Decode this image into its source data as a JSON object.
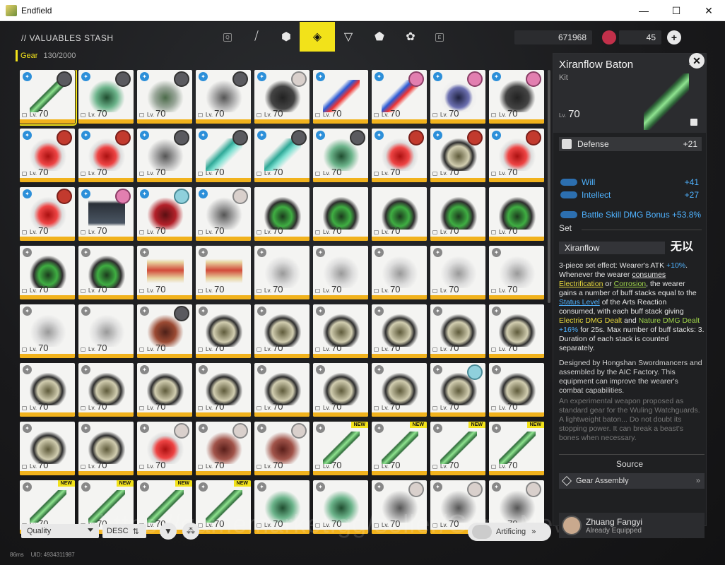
{
  "window": {
    "title": "Endfield",
    "minimize": "—",
    "maximize": "☐",
    "close": "✕"
  },
  "topbar": {
    "stash_title": "// VALUABLES STASH",
    "key_q": "Q",
    "key_e": "E",
    "tabs": [
      {
        "name": "all-tab",
        "icon": "⧸"
      },
      {
        "name": "cube-tab",
        "icon": "⬢"
      },
      {
        "name": "gear-tab",
        "icon": "◈",
        "active": true
      },
      {
        "name": "triangle-tab",
        "icon": "▽"
      },
      {
        "name": "box-tab",
        "icon": "⬟"
      },
      {
        "name": "settings-tab",
        "icon": "✿"
      }
    ],
    "currency1": "671968",
    "currency2": "45",
    "add": "+"
  },
  "category": {
    "label": "Gear",
    "count": "130/2000"
  },
  "grid": {
    "level_prefix": "Lv.",
    "level_value": "70",
    "new_label": "NEW",
    "rows": [
      [
        {
          "item": "it-baton",
          "badge": "blue",
          "avatar": "dark",
          "sel": true
        },
        {
          "item": "it-mech-green",
          "badge": "blue",
          "avatar": "dark"
        },
        {
          "item": "it-armor-green",
          "badge": "blue",
          "avatar": "dark"
        },
        {
          "item": "it-glove",
          "badge": "blue",
          "avatar": "dark"
        },
        {
          "item": "it-armor-black",
          "badge": "blue",
          "avatar": "light"
        },
        {
          "item": "it-blue-tool",
          "badge": "blue",
          "avatar": "none"
        },
        {
          "item": "it-blue-tool",
          "badge": "blue",
          "avatar": "pink"
        },
        {
          "item": "it-purple",
          "badge": "blue",
          "avatar": "pink"
        },
        {
          "item": "it-armor-black",
          "badge": "blue",
          "avatar": "pink"
        }
      ],
      [
        {
          "item": "it-red",
          "badge": "blue",
          "avatar": "red"
        },
        {
          "item": "it-red",
          "badge": "blue",
          "avatar": "red"
        },
        {
          "item": "it-glove",
          "badge": "blue",
          "avatar": "dark"
        },
        {
          "item": "it-teal",
          "badge": "blue",
          "avatar": "dark"
        },
        {
          "item": "it-teal",
          "badge": "blue",
          "avatar": "dark"
        },
        {
          "item": "it-mech-green",
          "badge": "blue",
          "avatar": "dark"
        },
        {
          "item": "it-red",
          "badge": "blue",
          "avatar": "red"
        },
        {
          "item": "it-khaki",
          "badge": "blue",
          "avatar": "red"
        },
        {
          "item": "it-red",
          "badge": "blue",
          "avatar": "red"
        }
      ],
      [
        {
          "item": "it-red",
          "badge": "blue",
          "avatar": "red"
        },
        {
          "item": "it-chip",
          "badge": "blue",
          "avatar": "pink"
        },
        {
          "item": "it-ladybug",
          "badge": "blue",
          "avatar": "cyan"
        },
        {
          "item": "it-glove",
          "badge": "blue",
          "avatar": "light"
        },
        {
          "item": "it-tank",
          "badge": "none",
          "avatar": "none"
        },
        {
          "item": "it-tank",
          "badge": "none",
          "avatar": "none"
        },
        {
          "item": "it-tank",
          "badge": "none",
          "avatar": "none"
        },
        {
          "item": "it-tank",
          "badge": "none",
          "avatar": "none"
        },
        {
          "item": "it-tank",
          "badge": "none",
          "avatar": "none"
        }
      ],
      [
        {
          "item": "it-tank",
          "badge": "gray",
          "avatar": "none"
        },
        {
          "item": "it-tank",
          "badge": "gray",
          "avatar": "none"
        },
        {
          "item": "it-scroll",
          "badge": "gray",
          "avatar": "none"
        },
        {
          "item": "it-scroll",
          "badge": "gray",
          "avatar": "none"
        },
        {
          "item": "it-silver",
          "badge": "gray",
          "avatar": "none"
        },
        {
          "item": "it-silver",
          "badge": "gray",
          "avatar": "none"
        },
        {
          "item": "it-silver",
          "badge": "gray",
          "avatar": "none"
        },
        {
          "item": "it-silver",
          "badge": "gray",
          "avatar": "none"
        },
        {
          "item": "it-silver",
          "badge": "gray",
          "avatar": "none"
        }
      ],
      [
        {
          "item": "it-silver",
          "badge": "gray",
          "avatar": "none"
        },
        {
          "item": "it-silver",
          "badge": "gray",
          "avatar": "none"
        },
        {
          "item": "it-brown",
          "badge": "gray",
          "avatar": "dark"
        },
        {
          "item": "it-khaki",
          "badge": "gray",
          "avatar": "none"
        },
        {
          "item": "it-khaki",
          "badge": "gray",
          "avatar": "none"
        },
        {
          "item": "it-khaki",
          "badge": "gray",
          "avatar": "none"
        },
        {
          "item": "it-khaki",
          "badge": "gray",
          "avatar": "none"
        },
        {
          "item": "it-khaki",
          "badge": "gray",
          "avatar": "none"
        },
        {
          "item": "it-khaki",
          "badge": "gray",
          "avatar": "none"
        }
      ],
      [
        {
          "item": "it-khaki",
          "badge": "gray",
          "avatar": "none"
        },
        {
          "item": "it-khaki",
          "badge": "gray",
          "avatar": "none"
        },
        {
          "item": "it-khaki",
          "badge": "gray",
          "avatar": "none"
        },
        {
          "item": "it-khaki",
          "badge": "gray",
          "avatar": "none"
        },
        {
          "item": "it-khaki",
          "badge": "gray",
          "avatar": "none"
        },
        {
          "item": "it-khaki",
          "badge": "gray",
          "avatar": "none"
        },
        {
          "item": "it-khaki",
          "badge": "gray",
          "avatar": "none"
        },
        {
          "item": "it-khaki",
          "badge": "gray",
          "avatar": "cyan"
        },
        {
          "item": "it-khaki",
          "badge": "gray",
          "avatar": "none"
        }
      ],
      [
        {
          "item": "it-khaki",
          "badge": "gray",
          "avatar": "none"
        },
        {
          "item": "it-khaki",
          "badge": "gray",
          "avatar": "none"
        },
        {
          "item": "it-red",
          "badge": "gray",
          "avatar": "light"
        },
        {
          "item": "it-fringe",
          "badge": "gray",
          "avatar": "light"
        },
        {
          "item": "it-fringe",
          "badge": "gray",
          "avatar": "light"
        },
        {
          "item": "it-baton",
          "badge": "gray",
          "avatar": "none",
          "new": true
        },
        {
          "item": "it-baton",
          "badge": "gray",
          "avatar": "none",
          "new": true
        },
        {
          "item": "it-baton",
          "badge": "gray",
          "avatar": "none",
          "new": true
        },
        {
          "item": "it-baton",
          "badge": "gray",
          "avatar": "none",
          "new": true
        }
      ],
      [
        {
          "item": "it-baton",
          "badge": "gray",
          "avatar": "none",
          "new": true
        },
        {
          "item": "it-baton",
          "badge": "gray",
          "avatar": "none",
          "new": true
        },
        {
          "item": "it-baton",
          "badge": "gray",
          "avatar": "none",
          "new": true
        },
        {
          "item": "it-baton",
          "badge": "gray",
          "avatar": "none",
          "new": true
        },
        {
          "item": "it-mech-green",
          "badge": "gray",
          "avatar": "none"
        },
        {
          "item": "it-mech-green",
          "badge": "gray",
          "avatar": "none"
        },
        {
          "item": "it-glove",
          "badge": "gray",
          "avatar": "light"
        },
        {
          "item": "it-glove",
          "badge": "gray",
          "avatar": "light"
        },
        {
          "item": "it-glove",
          "badge": "gray",
          "avatar": "light"
        }
      ]
    ]
  },
  "bottom": {
    "sort_value": "Quality",
    "sort_dir": "DESC",
    "sort_dir_icon": "⇅",
    "filter_icon": "▼",
    "share_icon": "⁂",
    "artificing": "Artificing",
    "artificing_chev": "»",
    "ping": "86ms",
    "uid": "UID: 4934311987",
    "watermark": "https://gamemarket.gg/seller/GameNews"
  },
  "detail": {
    "name": "Xiranflow Baton",
    "type": "Kit",
    "level_prefix": "Lv.",
    "level": "70",
    "main_stat": {
      "label": "Defense",
      "value": "+21"
    },
    "stats": [
      {
        "label": "Will",
        "value": "+41"
      },
      {
        "label": "Intellect",
        "value": "+27"
      },
      {
        "label": "Battle Skill DMG Bonus +53.8%",
        "value": ""
      }
    ],
    "set_header": "Set",
    "set_name": "Xiranflow",
    "set_logo": "无以",
    "desc": {
      "p1": "3-piece set effect: Wearer's ATK ",
      "p1_hl": "+10%",
      "p1b": ". Whenever the wearer ",
      "p1_consumes": "consumes",
      "p2_elec": "Electrification",
      "p2_or": " or ",
      "p2_corr": "Corrosion",
      "p2b": ", the wearer gains a number of buff stacks equal to the ",
      "p2_status": "Status Level",
      "p2c": " of the Arts Reaction consumed, with each buff stack giving ",
      "p2_elec_dmg": "Electric DMG Dealt",
      "p2_and": " and ",
      "p2_nat_dmg": "Nature DMG Dealt",
      "p2_hl": " +16%",
      "p2d": " for 25s. Max number of buff stacks: 3. Duration of each stack is counted separately."
    },
    "lore": "Designed by Hongshan Swordmancers and assembled by the AIC Factory. This equipment can improve the wearer's combat capabilities.",
    "flavor1": "An experimental weapon proposed as standard gear for the Wuling Watchguards.",
    "flavor2": "A lightweight baton... Do not doubt its stopping power. It can break a beast's bones when necessary.",
    "source_header": "Source",
    "source_item": "Gear Assembly",
    "source_chev": "»",
    "equipped_name": "Zhuang Fangyi",
    "equipped_status": "Already Equipped"
  },
  "colors": {
    "accent": "#f2e21a",
    "rarity_bar": "#f1b21c",
    "stat_blue": "#4fb2ff"
  }
}
